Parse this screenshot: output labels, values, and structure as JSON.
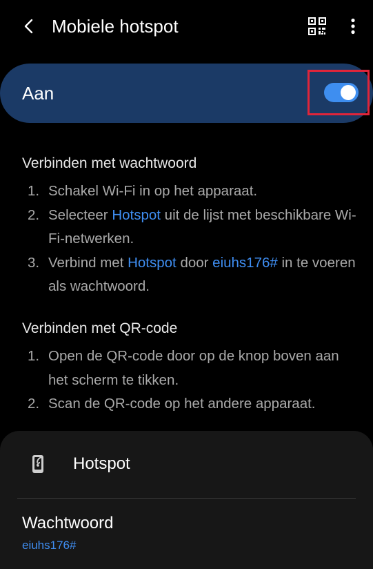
{
  "header": {
    "title": "Mobiele hotspot",
    "back_icon": "chevron-left-icon",
    "qr_icon": "qr-code-icon",
    "more_icon": "more-vertical-icon"
  },
  "master_switch": {
    "label": "Aan",
    "state": "on",
    "accent_color": "#3e8ef0",
    "bar_color": "#1b3a66",
    "highlight_color": "#e0253a"
  },
  "password_section": {
    "title": "Verbinden met wachtwoord",
    "step1": {
      "num": "1.",
      "text": "Schakel Wi-Fi in op het apparaat."
    },
    "step2": {
      "num": "2.",
      "pre": "Selecteer ",
      "link": "Hotspot",
      "post": " uit de lijst met beschikbare Wi-Fi-netwerken."
    },
    "step3": {
      "num": "3.",
      "pre": "Verbind met ",
      "link1": "Hotspot",
      "mid": " door ",
      "link2": "eiuhs176#",
      "post": " in te voeren als wachtwoord."
    }
  },
  "qr_section": {
    "title": "Verbinden met QR-code",
    "step1": {
      "num": "1.",
      "text": "Open de QR-code door op de knop boven aan het scherm te tikken."
    },
    "step2": {
      "num": "2.",
      "text": "Scan de QR-code op het andere apparaat."
    }
  },
  "card": {
    "hotspot_name": "Hotspot",
    "hotspot_icon": "hotspot-device-icon",
    "password_label": "Wachtwoord",
    "password_value": "eiuhs176#"
  }
}
